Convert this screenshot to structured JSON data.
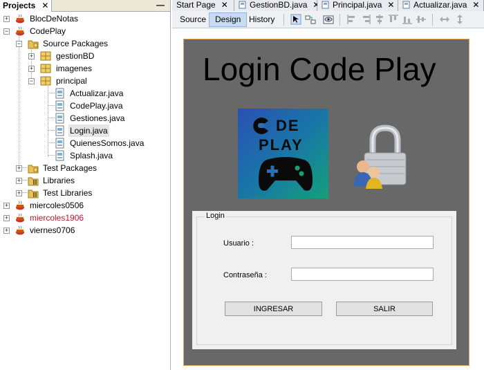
{
  "projects_panel": {
    "tab_label": "Projects",
    "close": "✕",
    "minimize": "—",
    "tree": [
      {
        "label": "BlocDeNotas"
      },
      {
        "label": "CodePlay"
      },
      {
        "label": "Source Packages"
      },
      {
        "label": "gestionBD"
      },
      {
        "label": "imagenes"
      },
      {
        "label": "principal"
      },
      {
        "label": "Actualizar.java"
      },
      {
        "label": "CodePlay.java"
      },
      {
        "label": "Gestiones.java"
      },
      {
        "label": "Login.java"
      },
      {
        "label": "QuienesSomos.java"
      },
      {
        "label": "Splash.java"
      },
      {
        "label": "Test Packages"
      },
      {
        "label": "Libraries"
      },
      {
        "label": "Test Libraries"
      },
      {
        "label": "miercoles0506"
      },
      {
        "label": "miercoles1906"
      },
      {
        "label": "viernes0706"
      }
    ]
  },
  "editor_tabs": [
    {
      "label": "Start Page"
    },
    {
      "label": "GestionBD.java"
    },
    {
      "label": "Principal.java"
    },
    {
      "label": "Actualizar.java"
    }
  ],
  "tab_close": "✕",
  "toolbar": {
    "source": "Source",
    "design": "Design",
    "history": "History"
  },
  "form": {
    "title": "Login Code Play",
    "logo_line1": "DE",
    "logo_line2": "PLAY",
    "login_legend": "Login",
    "usuario_label": "Usuario :",
    "password_label": "Contraseña :",
    "usuario_value": "",
    "password_value": "",
    "ingresar": "INGRESAR",
    "salir": "SALIR"
  },
  "colors": {
    "form_background": "#686868",
    "selected_view": "#c7dcf3",
    "highlighted_project": "#c8102e"
  }
}
